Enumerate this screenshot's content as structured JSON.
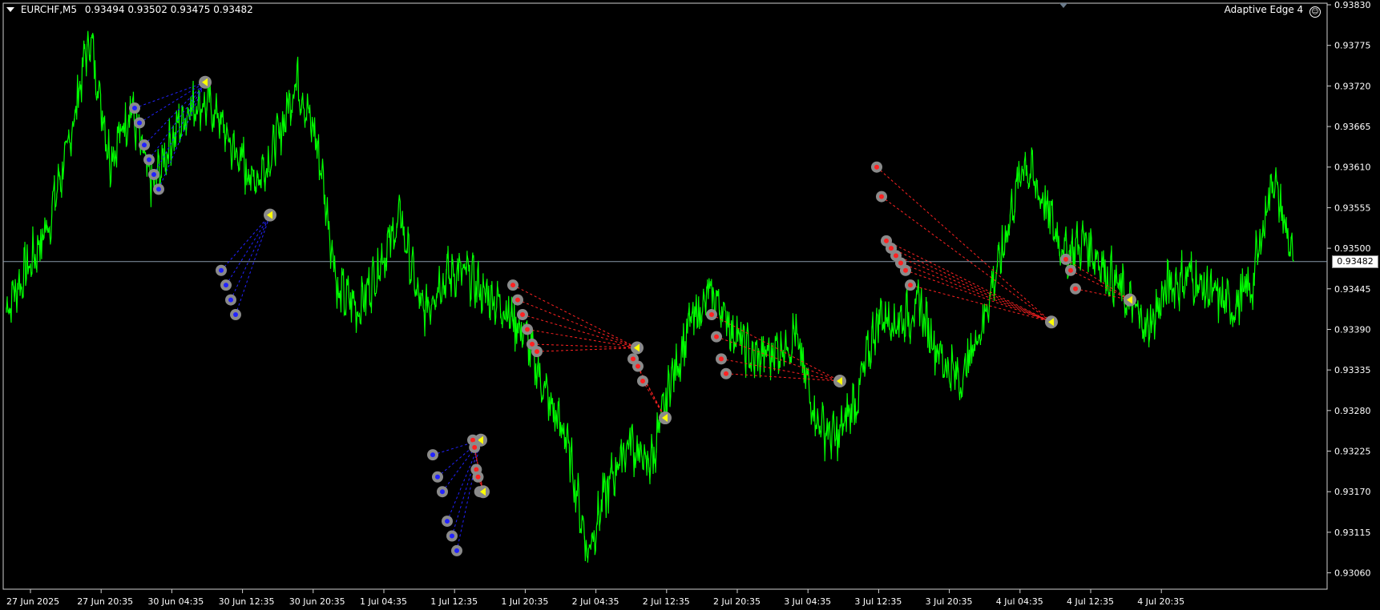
{
  "header": {
    "symbol": "EURCHF,M5",
    "ohlc": "0.93494 0.93502 0.93475 0.93482",
    "indicator": "Adaptive Edge 4"
  },
  "current_price": "0.93482",
  "price_axis": [
    "0.93830",
    "0.93775",
    "0.93720",
    "0.93665",
    "0.93610",
    "0.93555",
    "0.93500",
    "0.93445",
    "0.93390",
    "0.93335",
    "0.93280",
    "0.93225",
    "0.93170",
    "0.93115",
    "0.93060"
  ],
  "time_axis": [
    "27 Jun 2025",
    "27 Jun 20:35",
    "30 Jun 04:35",
    "30 Jun 12:35",
    "30 Jun 20:35",
    "1 Jul 04:35",
    "1 Jul 12:35",
    "1 Jul 20:35",
    "2 Jul 04:35",
    "2 Jul 12:35",
    "2 Jul 20:35",
    "3 Jul 04:35",
    "3 Jul 12:35",
    "3 Jul 20:35",
    "4 Jul 04:35",
    "4 Jul 12:35",
    "4 Jul 20:35"
  ],
  "colors": {
    "background": "#000000",
    "price_line": "#00ff00",
    "buy_signal": "#2222ff",
    "sell_signal": "#ff2222",
    "marker_ring": "#8a8a8a",
    "exit_marker": "#ffff00",
    "current_price_line": "#8899aa"
  },
  "chart_data": {
    "type": "line",
    "symbol": "EURCHF",
    "timeframe": "M5",
    "ylim": [
      0.9304,
      0.9383
    ],
    "x_ticks": [
      "27 Jun 2025",
      "27 Jun 20:35",
      "30 Jun 04:35",
      "30 Jun 12:35",
      "30 Jun 20:35",
      "1 Jul 04:35",
      "1 Jul 12:35",
      "1 Jul 20:35",
      "2 Jul 04:35",
      "2 Jul 12:35",
      "2 Jul 20:35",
      "3 Jul 04:35",
      "3 Jul 12:35",
      "3 Jul 20:35",
      "4 Jul 04:35",
      "4 Jul 12:35",
      "4 Jul 20:35"
    ],
    "keypoints": [
      [
        "27 Jun 2025",
        0.9342
      ],
      [
        "27 Jun 2025",
        0.9347
      ],
      [
        "27 Jun 2025",
        0.9353
      ],
      [
        "27 Jun 2025",
        0.9364
      ],
      [
        "27 Jun 2025",
        0.9379
      ],
      [
        "27 Jun 2025",
        0.9362
      ],
      [
        "27 Jun 20:35",
        0.9369
      ],
      [
        "27 Jun 20:35",
        0.9358
      ],
      [
        "27 Jun 20:35",
        0.9365
      ],
      [
        "27 Jun 20:35",
        0.937
      ],
      [
        "30 Jun 04:35",
        0.9369
      ],
      [
        "30 Jun 04:35",
        0.9363
      ],
      [
        "30 Jun 04:35",
        0.9359
      ],
      [
        "30 Jun 04:35",
        0.9364
      ],
      [
        "30 Jun 04:35",
        0.9373
      ],
      [
        "30 Jun 04:35",
        0.9364
      ],
      [
        "30 Jun 12:35",
        0.9344
      ],
      [
        "30 Jun 12:35",
        0.9342
      ],
      [
        "30 Jun 12:35",
        0.9348
      ],
      [
        "30 Jun 12:35",
        0.9354
      ],
      [
        "30 Jun 12:35",
        0.9341
      ],
      [
        "30 Jun 20:35",
        0.9346
      ],
      [
        "30 Jun 20:35",
        0.9347
      ],
      [
        "30 Jun 20:35",
        0.9344
      ],
      [
        "1 Jul 04:35",
        0.9342
      ],
      [
        "1 Jul 04:35",
        0.9338
      ],
      [
        "1 Jul 04:35",
        0.933
      ],
      [
        "1 Jul 04:35",
        0.9324
      ],
      [
        "1 Jul 12:35",
        0.9309
      ],
      [
        "1 Jul 12:35",
        0.9318
      ],
      [
        "1 Jul 12:35",
        0.9324
      ],
      [
        "1 Jul 12:35",
        0.932
      ],
      [
        "1 Jul 12:35",
        0.9332
      ],
      [
        "1 Jul 20:35",
        0.934
      ],
      [
        "1 Jul 20:35",
        0.9344
      ],
      [
        "1 Jul 20:35",
        0.9339
      ],
      [
        "2 Jul 04:35",
        0.9335
      ],
      [
        "2 Jul 04:35",
        0.9336
      ],
      [
        "2 Jul 04:35",
        0.9338
      ],
      [
        "2 Jul 12:35",
        0.9327
      ],
      [
        "2 Jul 12:35",
        0.9324
      ],
      [
        "2 Jul 12:35",
        0.933
      ],
      [
        "2 Jul 20:35",
        0.9341
      ],
      [
        "2 Jul 20:35",
        0.934
      ],
      [
        "2 Jul 20:35",
        0.9342
      ],
      [
        "3 Jul 04:35",
        0.9335
      ],
      [
        "3 Jul 04:35",
        0.9332
      ],
      [
        "3 Jul 04:35",
        0.934
      ],
      [
        "3 Jul 12:35",
        0.935
      ],
      [
        "3 Jul 12:35",
        0.9362
      ],
      [
        "3 Jul 12:35",
        0.9356
      ],
      [
        "3 Jul 20:35",
        0.9349
      ],
      [
        "3 Jul 20:35",
        0.9351
      ],
      [
        "3 Jul 20:35",
        0.9347
      ],
      [
        "4 Jul 04:35",
        0.9343
      ],
      [
        "4 Jul 04:35",
        0.9339
      ],
      [
        "4 Jul 04:35",
        0.9345
      ],
      [
        "4 Jul 12:35",
        0.9346
      ],
      [
        "4 Jul 12:35",
        0.9344
      ],
      [
        "4 Jul 12:35",
        0.9342
      ],
      [
        "4 Jul 20:35",
        0.9345
      ],
      [
        "4 Jul 20:35",
        0.936
      ],
      [
        "4 Jul 20:35",
        0.93482
      ]
    ],
    "signal_groups": [
      {
        "side": "buy",
        "entries": [
          0.9369,
          0.9367,
          0.9364,
          0.9362,
          0.936,
          0.9358
        ],
        "exit": 0.93725
      },
      {
        "side": "buy",
        "entries": [
          0.9347,
          0.9345,
          0.9343,
          0.9341
        ],
        "exit": 0.93545
      },
      {
        "side": "buy",
        "entries": [
          0.9322,
          0.9319,
          0.9317,
          0.9313,
          0.9311,
          0.9309
        ],
        "exit": 0.9324
      },
      {
        "side": "sell",
        "entries": [
          0.9324,
          0.9323,
          0.932,
          0.9319,
          0.9317
        ],
        "exit": 0.9317
      },
      {
        "side": "sell",
        "entries": [
          0.9345,
          0.9343,
          0.9341,
          0.9339,
          0.9337,
          0.9336
        ],
        "exit": 0.93365
      },
      {
        "side": "sell",
        "entries": [
          0.9335,
          0.9334,
          0.9332
        ],
        "exit": 0.9327
      },
      {
        "side": "sell",
        "entries": [
          0.9341,
          0.9338,
          0.9335,
          0.9333
        ],
        "exit": 0.9332
      },
      {
        "side": "sell",
        "entries": [
          0.9361,
          0.9357,
          0.9351,
          0.935,
          0.9349,
          0.9348,
          0.9347,
          0.9345
        ],
        "exit": 0.934
      },
      {
        "side": "sell",
        "entries": [
          0.93485,
          0.9347,
          0.93445
        ],
        "exit": 0.9343
      }
    ],
    "current_price": 0.93482
  }
}
